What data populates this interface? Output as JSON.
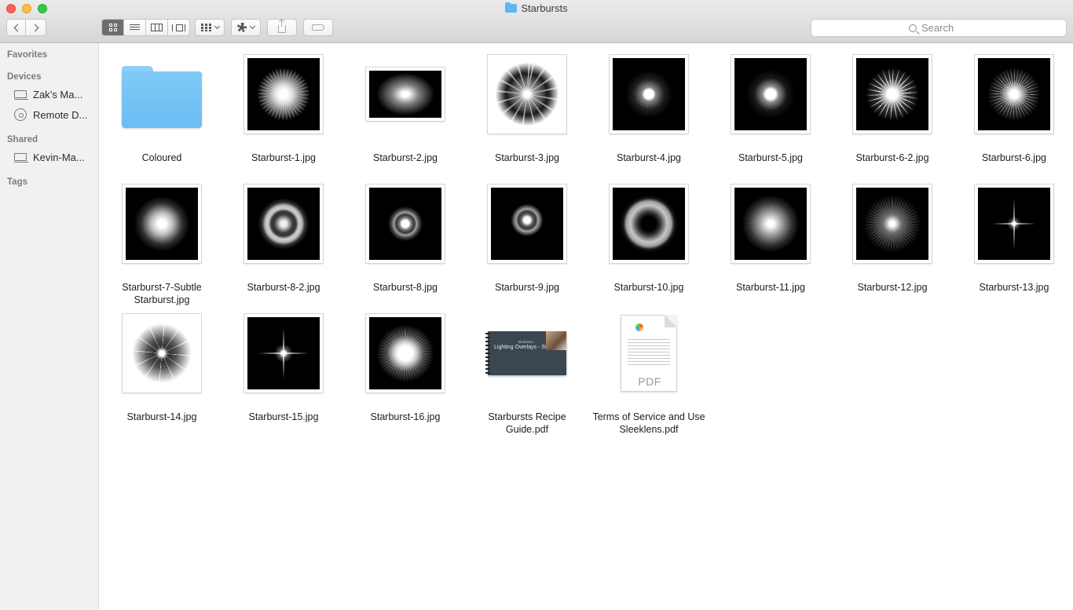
{
  "window": {
    "title": "Starbursts"
  },
  "toolbar": {
    "icons": {
      "back": "chevron-left-icon",
      "forward": "chevron-right-icon",
      "icon_view": "icon-view-icon",
      "list_view": "list-view-icon",
      "column_view": "column-view-icon",
      "coverflow_view": "cover-flow-icon",
      "arrange": "arrange-icon",
      "action": "gear-icon",
      "share": "share-icon",
      "tags": "tag-icon"
    },
    "active_view": "icon"
  },
  "search": {
    "placeholder": "Search"
  },
  "sidebar": {
    "sections": [
      {
        "header": "Favorites",
        "items": []
      },
      {
        "header": "Devices",
        "items": [
          {
            "label": "Zak’s Ma...",
            "icon": "laptop-icon"
          },
          {
            "label": "Remote D...",
            "icon": "disc-icon"
          }
        ]
      },
      {
        "header": "Shared",
        "items": [
          {
            "label": "Kevin-Ma...",
            "icon": "laptop-icon"
          }
        ]
      },
      {
        "header": "Tags",
        "items": []
      }
    ]
  },
  "files": [
    {
      "name": "Coloured",
      "kind": "folder"
    },
    {
      "name": "Starburst-1.jpg",
      "kind": "image"
    },
    {
      "name": "Starburst-2.jpg",
      "kind": "image-wide"
    },
    {
      "name": "Starburst-3.jpg",
      "kind": "image"
    },
    {
      "name": "Starburst-4.jpg",
      "kind": "image"
    },
    {
      "name": "Starburst-5.jpg",
      "kind": "image"
    },
    {
      "name": "Starburst-6-2.jpg",
      "kind": "image"
    },
    {
      "name": "Starburst-6.jpg",
      "kind": "image"
    },
    {
      "name": "Starburst-7-Subtle Starburst.jpg",
      "kind": "image"
    },
    {
      "name": "Starburst-8-2.jpg",
      "kind": "image"
    },
    {
      "name": "Starburst-8.jpg",
      "kind": "image"
    },
    {
      "name": "Starburst-9.jpg",
      "kind": "image"
    },
    {
      "name": "Starburst-10.jpg",
      "kind": "image"
    },
    {
      "name": "Starburst-11.jpg",
      "kind": "image"
    },
    {
      "name": "Starburst-12.jpg",
      "kind": "image"
    },
    {
      "name": "Starburst-13.jpg",
      "kind": "image"
    },
    {
      "name": "Starburst-14.jpg",
      "kind": "image"
    },
    {
      "name": "Starburst-15.jpg",
      "kind": "image"
    },
    {
      "name": "Starburst-16.jpg",
      "kind": "image"
    },
    {
      "name": "Starbursts Recipe Guide.pdf",
      "kind": "guide",
      "cover_title": "Lighting Overlays - Starbursts",
      "cover_brand": "Sleeklens"
    },
    {
      "name": "Terms of Service and Use Sleeklens.pdf",
      "kind": "pdf",
      "doc_tag": "PDF"
    }
  ],
  "colors": {
    "folder": "#6cbdf2",
    "sidebar_bg": "#f1f1f1",
    "active_segment": "#6d6d6d"
  }
}
